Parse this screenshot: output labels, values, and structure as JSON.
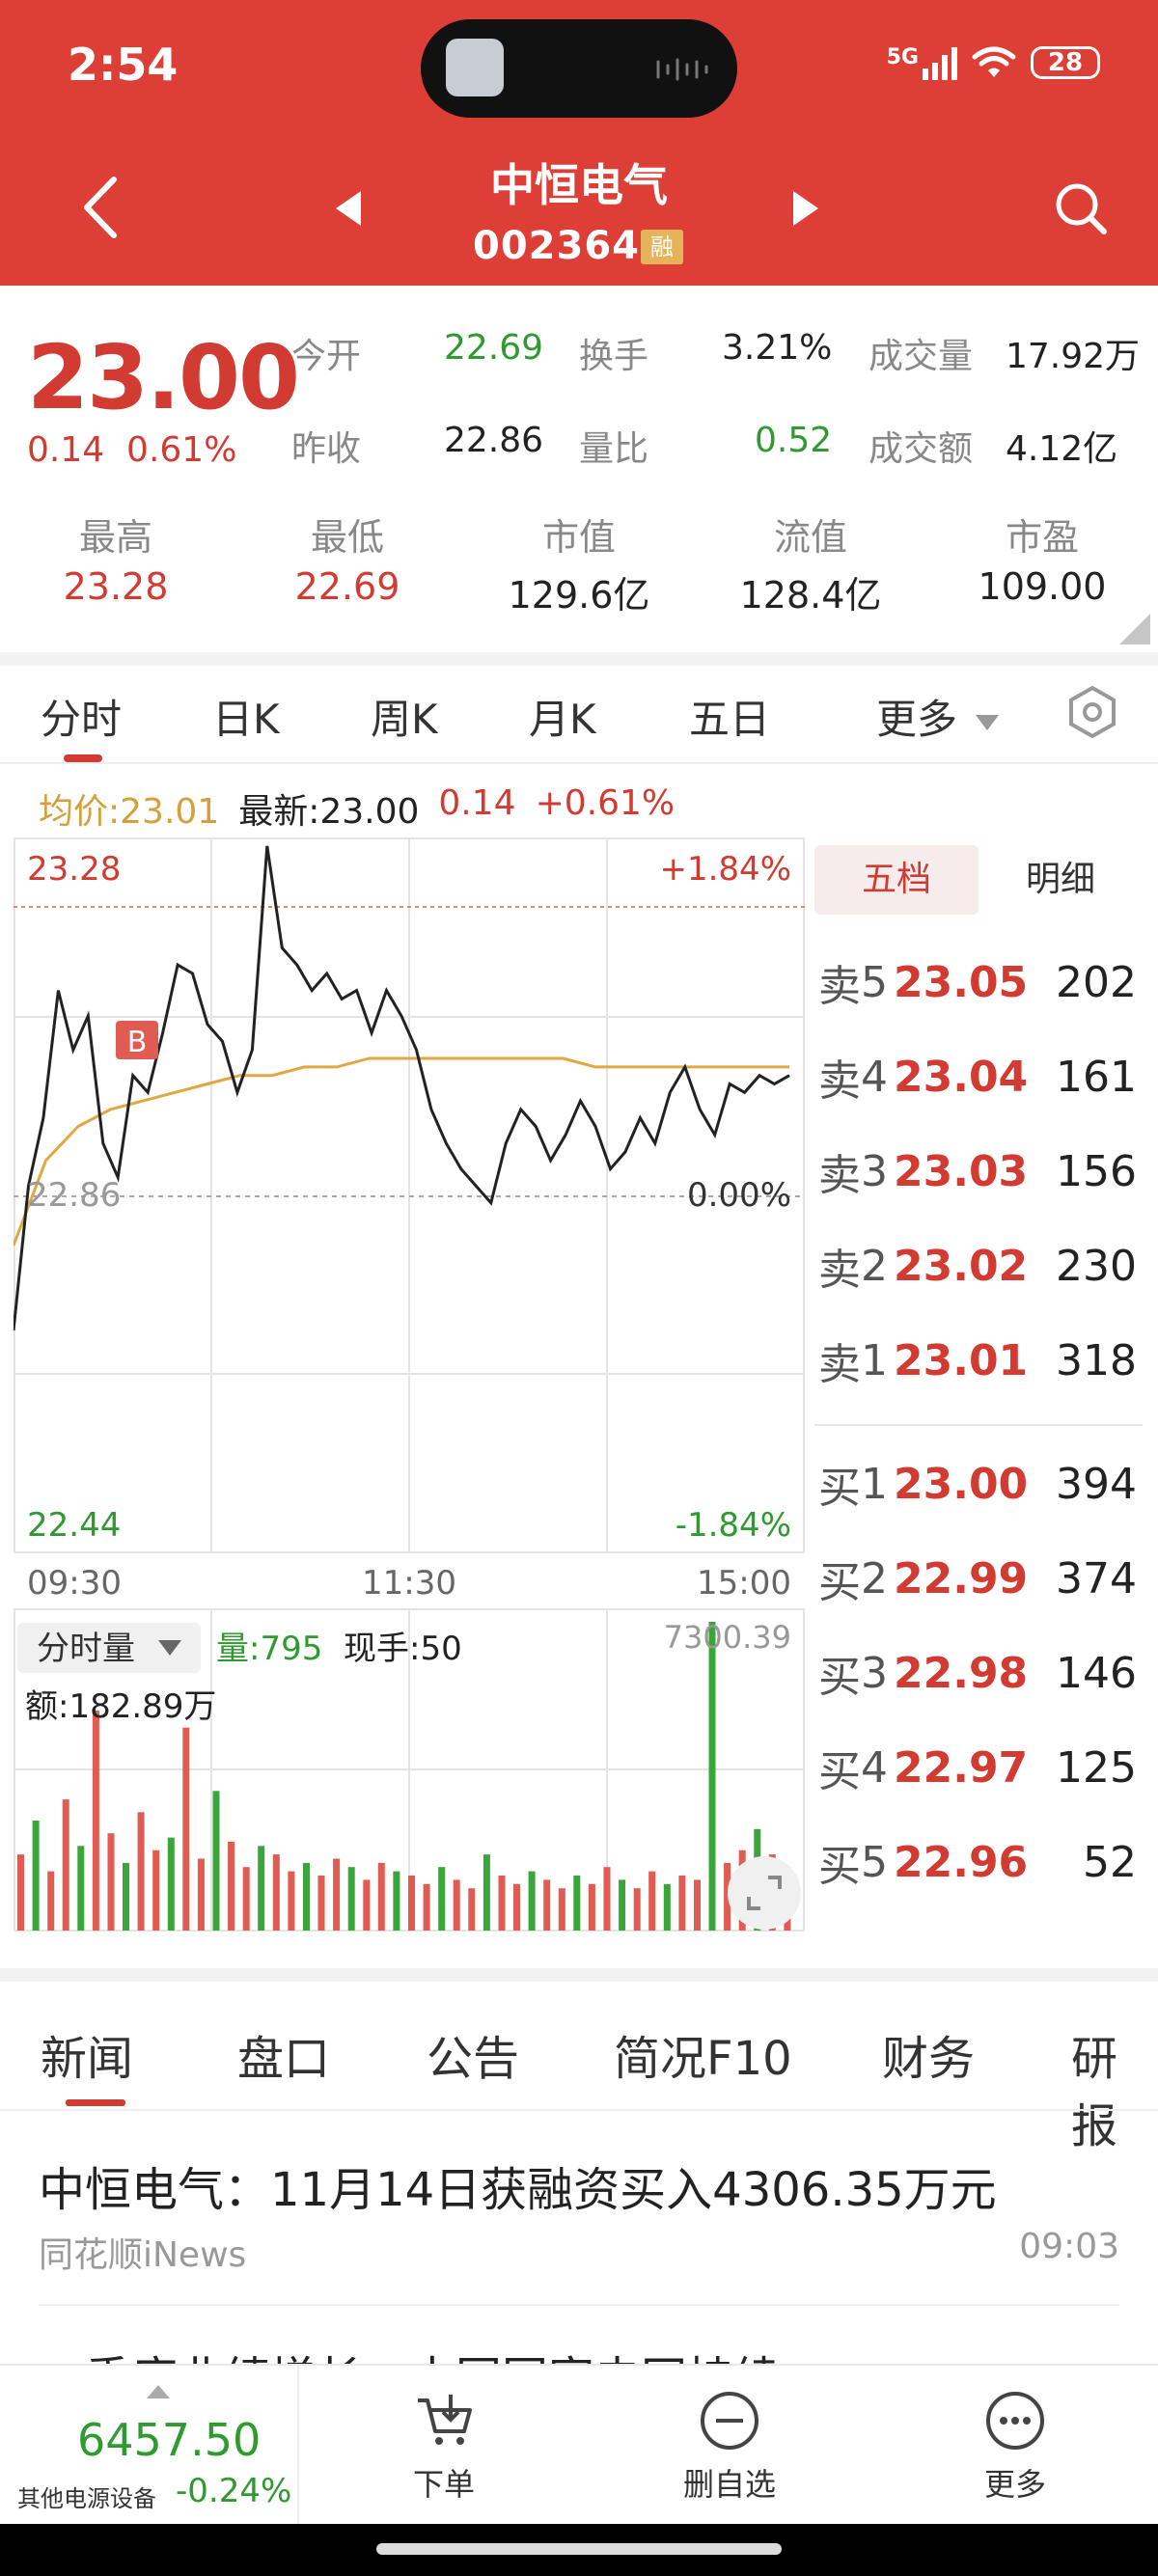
{
  "status_bar": {
    "time": "2:54",
    "network": "5G",
    "battery": "28"
  },
  "header": {
    "title": "中恒电气",
    "code": "002364",
    "margin_badge": "融"
  },
  "quote": {
    "price": "23.00",
    "change": "0.14",
    "change_pct": "0.61%",
    "open_label": "今开",
    "open": "22.69",
    "turnover_label": "换手",
    "turnover": "3.21%",
    "volume_label": "成交量",
    "volume": "17.92万",
    "prev_close_label": "昨收",
    "prev_close": "22.86",
    "vol_ratio_label": "量比",
    "vol_ratio": "0.52",
    "amount_label": "成交额",
    "amount": "4.12亿",
    "metrics": [
      {
        "label": "最高",
        "value": "23.28"
      },
      {
        "label": "最低",
        "value": "22.69"
      },
      {
        "label": "市值",
        "value": "129.6亿"
      },
      {
        "label": "流值",
        "value": "128.4亿"
      },
      {
        "label": "市盈",
        "value": "109.00"
      }
    ]
  },
  "chart_tabs": [
    "分时",
    "日K",
    "周K",
    "月K",
    "五日",
    "更多"
  ],
  "summary": {
    "avg": "均价:23.01",
    "latest": "最新:23.00",
    "chg": "0.14",
    "pct": "+0.61%"
  },
  "intraday": {
    "y_top": "23.28",
    "y_top_pct": "+1.84%",
    "y_mid": "22.86",
    "y_mid_pct": "0.00%",
    "y_bot": "22.44",
    "y_bot_pct": "-1.84%",
    "times": [
      "09:30",
      "11:30",
      "15:00"
    ],
    "buy_marker": "B",
    "volume_selector": "分时量",
    "volume_now": "量:795",
    "current_hand": "现手:50",
    "volume_max": "7300.39",
    "amount": "额:182.89万"
  },
  "chart_data": {
    "type": "line",
    "title": "",
    "x_labels": [
      "09:30",
      "11:30",
      "15:00"
    ],
    "ylim": [
      22.44,
      23.28
    ],
    "reference": 22.86,
    "series": [
      {
        "values": [
          22.7,
          22.87,
          22.95,
          23.1,
          23.03,
          23.07,
          22.92,
          22.88,
          23.0,
          22.98,
          23.05,
          23.13,
          23.12,
          23.06,
          23.04,
          22.98,
          23.03,
          23.27,
          23.15,
          23.13,
          23.1,
          23.12,
          23.09,
          23.1,
          23.05,
          23.1,
          23.07,
          23.03,
          22.96,
          22.92,
          22.89,
          22.87,
          22.85,
          22.92,
          22.96,
          22.94,
          22.9,
          22.93,
          22.97,
          22.94,
          22.89,
          22.91,
          22.95,
          22.92,
          22.98,
          23.01,
          22.96,
          22.93,
          22.99,
          22.98,
          23.0,
          22.99,
          23.0
        ]
      },
      {
        "values": [
          22.8,
          22.9,
          22.94,
          22.96,
          22.97,
          22.98,
          22.99,
          23.0,
          23.0,
          23.01,
          23.01,
          23.02,
          23.02,
          23.02,
          23.02,
          23.02,
          23.02,
          23.02,
          23.01,
          23.01,
          23.01,
          23.01,
          23.01,
          23.01,
          23.01
        ]
      }
    ],
    "volume": [
      1800,
      2600,
      1400,
      3100,
      2000,
      5200,
      2300,
      1600,
      2800,
      1900,
      2200,
      4800,
      1700,
      3300,
      2100,
      1500,
      2000,
      1800,
      1400,
      1600,
      1300,
      1700,
      1500,
      1200,
      1600,
      1400,
      1300,
      1100,
      1500,
      1200,
      1000,
      1800,
      1300,
      1100,
      1400,
      1200,
      1000,
      1300,
      1100,
      1500,
      1200,
      1000,
      1400,
      1100,
      1300,
      1200,
      7300,
      1600,
      1900,
      2400,
      1800,
      1500
    ]
  },
  "order_book": {
    "tabs": [
      "五档",
      "明细"
    ],
    "sell_label": "卖",
    "buy_label": "买",
    "asks": [
      {
        "level": "5",
        "price": "23.05",
        "vol": "202"
      },
      {
        "level": "4",
        "price": "23.04",
        "vol": "161"
      },
      {
        "level": "3",
        "price": "23.03",
        "vol": "156"
      },
      {
        "level": "2",
        "price": "23.02",
        "vol": "230"
      },
      {
        "level": "1",
        "price": "23.01",
        "vol": "318"
      }
    ],
    "bids": [
      {
        "level": "1",
        "price": "23.00",
        "vol": "394"
      },
      {
        "level": "2",
        "price": "22.99",
        "vol": "374"
      },
      {
        "level": "3",
        "price": "22.98",
        "vol": "146"
      },
      {
        "level": "4",
        "price": "22.97",
        "vol": "125"
      },
      {
        "level": "5",
        "price": "22.96",
        "vol": "52"
      }
    ]
  },
  "news_tabs": [
    "新闻",
    "盘口",
    "公告",
    "简况F10",
    "财务",
    "研报"
  ],
  "news": [
    {
      "title": "中恒电气：11月14日获融资买入4306.35万元",
      "source": "同花顺iNews",
      "time": "09:03"
    },
    {
      "title": "一季度业绩增长，中国国家电网持续"
    }
  ],
  "bottom_bar": {
    "index_value": "6457.50",
    "index_name": "其他电源设备",
    "index_change": "-0.24%",
    "buttons": [
      "下单",
      "删自选",
      "更多"
    ]
  },
  "colors": {
    "header_red": "#dd3e36",
    "price_red": "#d23b32",
    "price_green": "#2f9a2f",
    "avg_line": "#e0a840"
  }
}
